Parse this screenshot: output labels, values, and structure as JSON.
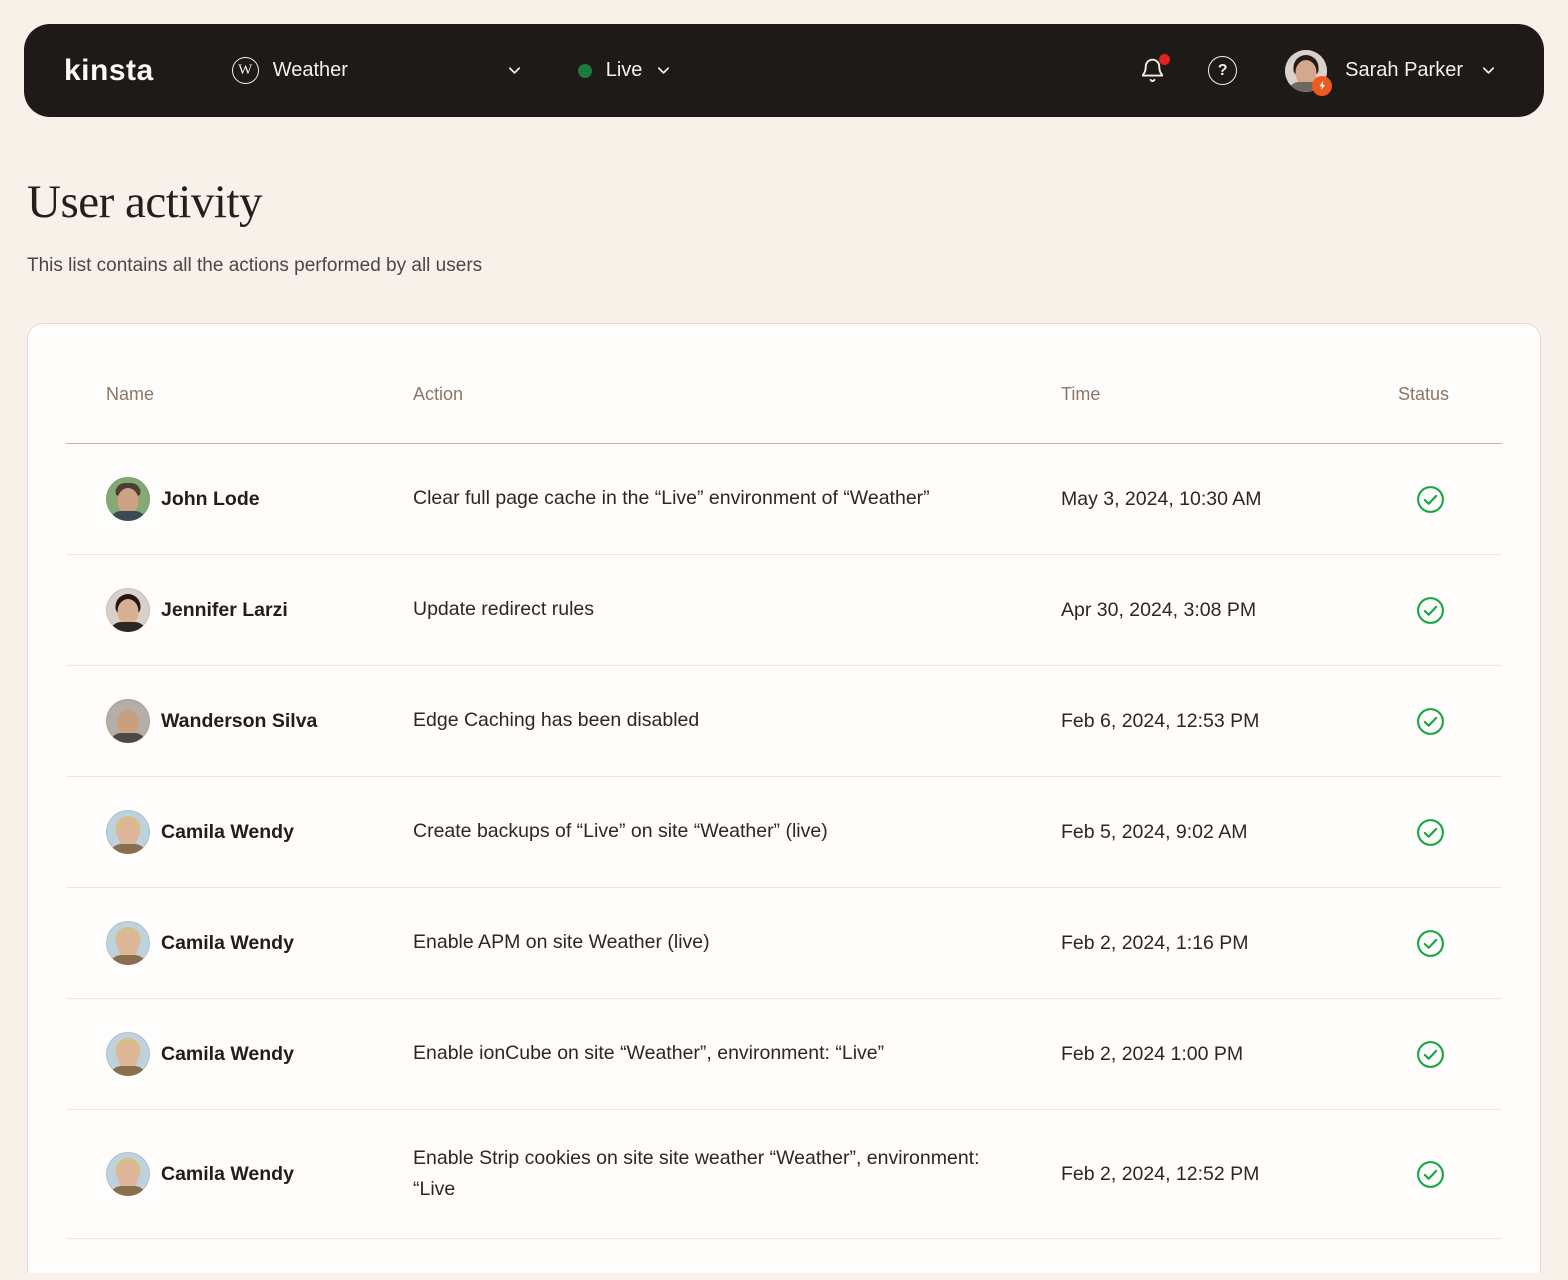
{
  "navbar": {
    "logo": "kinsta",
    "site_selector": {
      "icon": "wordpress-icon",
      "label": "Weather"
    },
    "env_selector": {
      "icon": "live-status-dot",
      "label": "Live"
    },
    "notifications": {
      "icon": "bell-icon",
      "has_unread": true
    },
    "help": {
      "icon": "help-icon"
    },
    "user": {
      "name": "Sarah Parker",
      "badge_icon": "lightning-bolt-icon"
    }
  },
  "page": {
    "title": "User activity",
    "subtitle": "This list contains all the actions performed by all users"
  },
  "table": {
    "columns": [
      "Name",
      "Action",
      "Time",
      "Status"
    ],
    "rows": [
      {
        "name": "John Lode",
        "avatar": "john",
        "action": "Clear full page cache in the “Live” environment of “Weather”",
        "time": "May 3, 2024, 10:30 AM",
        "status": "success"
      },
      {
        "name": "Jennifer Larzi",
        "avatar": "jennifer",
        "action": "Update redirect rules",
        "time": "Apr 30, 2024, 3:08 PM",
        "status": "success"
      },
      {
        "name": "Wanderson Silva",
        "avatar": "wanderson",
        "action": "Edge Caching has been disabled",
        "time": "Feb 6, 2024, 12:53 PM",
        "status": "success"
      },
      {
        "name": "Camila Wendy",
        "avatar": "camila",
        "action": "Create backups of “Live” on site “Weather” (live)",
        "time": "Feb 5, 2024, 9:02 AM",
        "status": "success"
      },
      {
        "name": "Camila Wendy",
        "avatar": "camila",
        "action": "Enable APM on site Weather (live)",
        "time": "Feb 2, 2024, 1:16 PM",
        "status": "success"
      },
      {
        "name": "Camila Wendy",
        "avatar": "camila",
        "action": "Enable ionCube on site “Weather”, environment: “Live”",
        "time": "Feb 2, 2024 1:00 PM",
        "status": "success"
      },
      {
        "name": "Camila Wendy",
        "avatar": "camila",
        "action": "Enable Strip cookies on site site weather “Weather”, environment: “Live",
        "time": "Feb 2, 2024, 12:52 PM",
        "status": "success"
      }
    ],
    "status_icon": "check-circle-icon"
  },
  "colors": {
    "navbar_bg": "#1d1a17",
    "page_bg": "#f7f1ea",
    "card_bg": "#fffdfb",
    "success_green": "#12a63f",
    "live_dot_green": "#1e7b3f",
    "notification_red": "#e0241b",
    "badge_orange": "#f0591e"
  }
}
